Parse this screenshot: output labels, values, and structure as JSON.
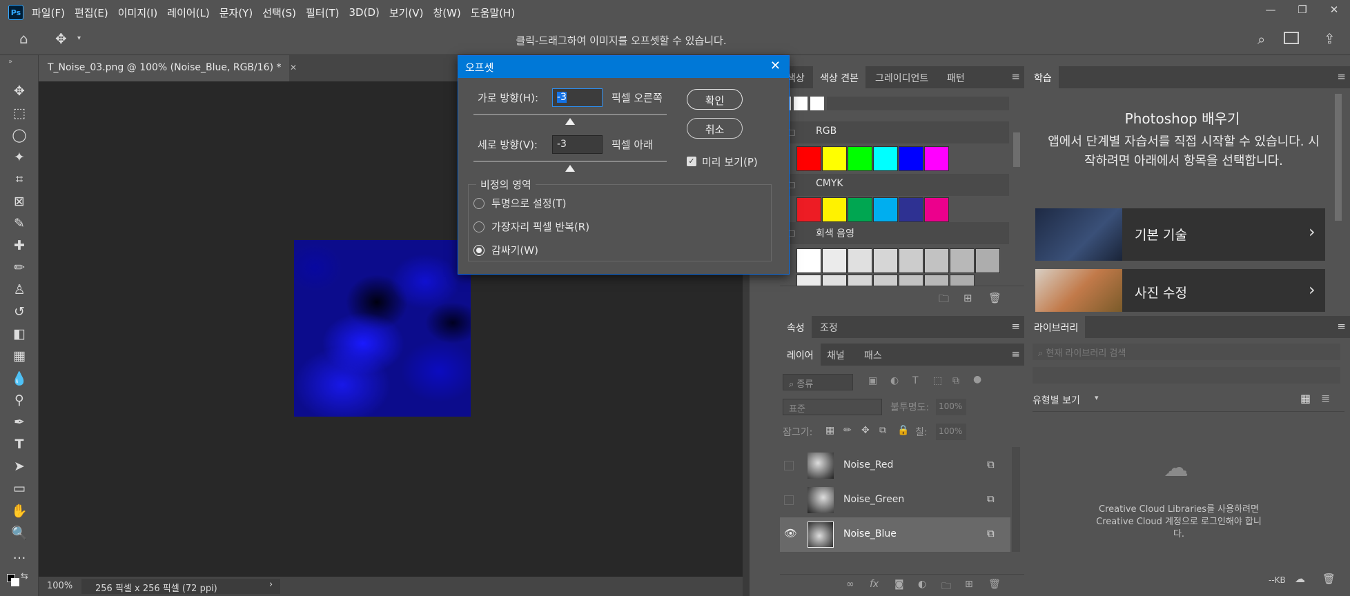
{
  "app": {
    "logo": "Ps"
  },
  "menu": [
    "파일(F)",
    "편집(E)",
    "이미지(I)",
    "레이어(L)",
    "문자(Y)",
    "선택(S)",
    "필터(T)",
    "3D(D)",
    "보기(V)",
    "창(W)",
    "도움말(H)"
  ],
  "options_bar": {
    "hint": "클릭-드래그하여 이미지를 오프셋할 수 있습니다."
  },
  "document": {
    "tab_title": "T_Noise_03.png @ 100% (Noise_Blue, RGB/16) *",
    "zoom": "100%",
    "size_info": "256 픽셀 x 256 픽셀 (72 ppi)"
  },
  "dialog": {
    "title": "오프셋",
    "horizontal_label": "가로 방향(H):",
    "horizontal_value": "-3",
    "horizontal_unit": "픽셀 오른쪽",
    "vertical_label": "세로 방향(V):",
    "vertical_value": "-3",
    "vertical_unit": "픽셀 아래",
    "ok": "확인",
    "cancel": "취소",
    "preview": "미리 보기(P)",
    "undefined_area": "비정의 영역",
    "options": [
      "투명으로 설정(T)",
      "가장자리 픽셀 반복(R)",
      "감싸기(W)"
    ],
    "selected_option": "감싸기(W)"
  },
  "swatches_panel": {
    "tabs": [
      "색상",
      "색상 견본",
      "그레이디언트",
      "패턴"
    ],
    "active_tab": "색상 견본",
    "groups": [
      {
        "name": "RGB",
        "colors": [
          "#ff0000",
          "#ffff00",
          "#00ff00",
          "#00ffff",
          "#0000ff",
          "#ff00ff"
        ]
      },
      {
        "name": "CMYK",
        "colors": [
          "#ed1c24",
          "#fff200",
          "#00a651",
          "#00aeef",
          "#2e3192",
          "#ec008c"
        ]
      },
      {
        "name": "회색 음영",
        "colors": [
          "#ffffff",
          "#ebebeb",
          "#e0e0e0",
          "#d6d6d6",
          "#cccccc",
          "#c2c2c2",
          "#b8b8b8",
          "#adadad"
        ]
      }
    ]
  },
  "learn_panel": {
    "tab": "학습",
    "title": "Photoshop 배우기",
    "description": "앱에서 단계별 자습서를 직접 시작할 수 있습니다. 시작하려면 아래에서 항목을 선택합니다.",
    "cards": [
      "기본 기술",
      "사진 수정"
    ]
  },
  "properties_panel": {
    "tabs": [
      "속성",
      "조정"
    ]
  },
  "layers_panel": {
    "tabs": [
      "레이어",
      "채널",
      "패스"
    ],
    "filter_placeholder": "종류",
    "blend_mode": "표준",
    "opacity_label": "불투명도:",
    "opacity": "100%",
    "lock_label": "잠그기:",
    "fill_label": "칠:",
    "fill": "100%",
    "layers": [
      {
        "name": "Noise_Red",
        "visible": false
      },
      {
        "name": "Noise_Green",
        "visible": false
      },
      {
        "name": "Noise_Blue",
        "visible": true,
        "selected": true
      }
    ]
  },
  "libraries_panel": {
    "tab": "라이브러리",
    "search_placeholder": "현재 라이브러리 검색",
    "view_label": "유형별 보기",
    "message": "Creative Cloud Libraries를 사용하려면 Creative Cloud 계정으로 로그인해야 합니다.",
    "size": "--KB"
  }
}
